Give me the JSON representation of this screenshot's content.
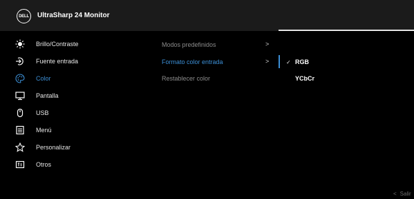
{
  "header": {
    "logo_text": "DELL",
    "title": "UltraSharp 24 Monitor"
  },
  "menu": [
    {
      "label": "Brillo/Contraste",
      "icon": "brightness-icon"
    },
    {
      "label": "Fuente entrada",
      "icon": "input-source-icon"
    },
    {
      "label": "Color",
      "icon": "color-palette-icon",
      "active": true
    },
    {
      "label": "Pantalla",
      "icon": "display-icon"
    },
    {
      "label": "USB",
      "icon": "usb-mouse-icon"
    },
    {
      "label": "Menú",
      "icon": "menu-icon"
    },
    {
      "label": "Personalizar",
      "icon": "star-icon"
    },
    {
      "label": "Otros",
      "icon": "info-icon"
    }
  ],
  "submenu": [
    {
      "label": "Modos predefinidos",
      "has_arrow": true
    },
    {
      "label": "Formato color entrada",
      "has_arrow": true,
      "active": true
    },
    {
      "label": "Restablecer color",
      "has_arrow": false
    }
  ],
  "arrow_glyph": ">",
  "options": [
    {
      "label": "RGB",
      "checked": true,
      "check_glyph": "✓"
    },
    {
      "label": "YCbCr",
      "checked": false
    }
  ],
  "exit": {
    "chevron": "<",
    "label": "Salir"
  },
  "colors": {
    "accent": "#3c8fd6",
    "background": "#000000",
    "header": "#1b1b1b"
  }
}
